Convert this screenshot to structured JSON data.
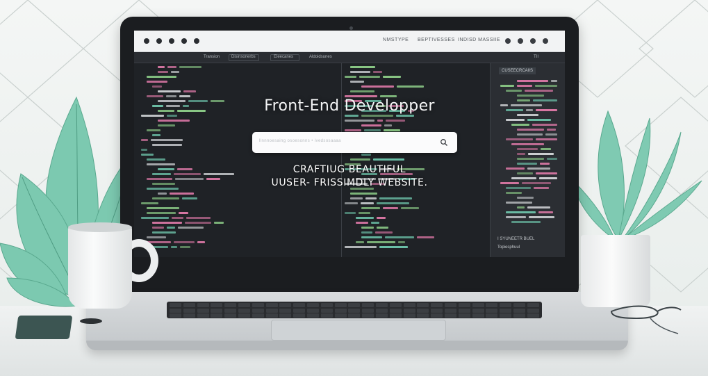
{
  "browser": {
    "nav_links": [
      "NMSTYPE",
      "BEPTIVESSES",
      "INDISD MASSIIE"
    ]
  },
  "editor": {
    "tabs": [
      "Transion",
      "Disinsonerbs",
      "Eleecanes",
      "Aldoidsunes"
    ],
    "panel_title": "CUSEECRCAIIS",
    "panel_footer": [
      "I SYUNEETR BUEL",
      "Topiesphuul"
    ]
  },
  "hero": {
    "title": "Front-End Developper",
    "search_placeholder": "llnnnoesaing osoesonns  •  ivedsosaaaa",
    "tagline_line1": "CRAFTIUG BEAUTIFUL",
    "tagline_line2": "UUSER- FRISSIMDLY WEBSITE."
  },
  "colors": {
    "accent_teal": "#6fc7ad",
    "screen_bg": "#1f2226",
    "code_green": "#8fd08a",
    "code_pink": "#e07aa9",
    "code_white": "#d6d9dc"
  },
  "icons": [
    "search-icon",
    "plant-left",
    "plant-right",
    "mug",
    "glasses"
  ]
}
